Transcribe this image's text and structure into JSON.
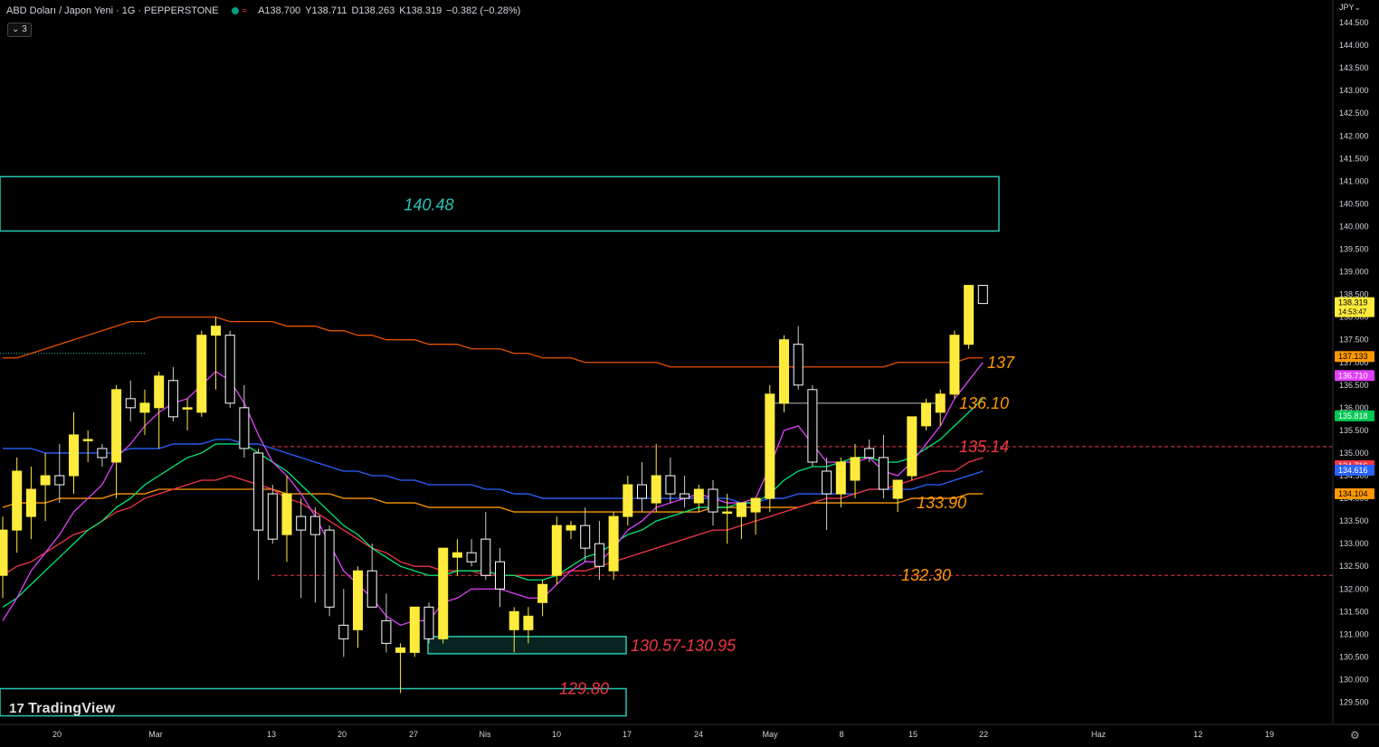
{
  "header": {
    "symbol": "ABD Doları / Japon Yeni · 1G · PEPPERSTONE",
    "wave_glyph": "≈",
    "open": "A138.700",
    "high": "Y138.711",
    "low": "D138.263",
    "close": "K138.319",
    "change": "−0.382 (−0.28%)"
  },
  "indicator_toggle": "⌄ 3",
  "currency_button": "JPY⌄",
  "logo": {
    "mark": "17",
    "text": "TradingView"
  },
  "settings_glyph": "⚙",
  "colors": {
    "bull": "#ffeb3b",
    "bear": "#000000",
    "bear_border": "#ffffff",
    "teal": "#26c6b4",
    "orange": "#ff9800",
    "red": "#f23645",
    "magenta": "#e040fb",
    "green": "#00e676",
    "blue": "#2962ff"
  },
  "chart_data": {
    "type": "candlestick",
    "symbol": "USDJPY",
    "timeframe": "1G",
    "y_axis": {
      "min": 129.3,
      "max": 144.8,
      "ticks": [
        "129.500",
        "130.000",
        "130.500",
        "131.000",
        "131.500",
        "132.000",
        "132.500",
        "133.000",
        "133.500",
        "134.000",
        "134.500",
        "135.000",
        "135.500",
        "136.000",
        "136.500",
        "137.000",
        "137.500",
        "138.000",
        "138.500",
        "139.000",
        "139.500",
        "140.000",
        "140.500",
        "141.000",
        "141.500",
        "142.000",
        "142.500",
        "143.000",
        "143.500",
        "144.000",
        "144.500"
      ]
    },
    "x_axis_labels": [
      "20",
      "Mar",
      "13",
      "20",
      "27",
      "Nis",
      "10",
      "17",
      "24",
      "May",
      "8",
      "15",
      "22",
      "Haz",
      "12",
      "19"
    ],
    "candles": [
      {
        "o": 132.3,
        "h": 133.6,
        "l": 131.8,
        "c": 133.3
      },
      {
        "o": 133.3,
        "h": 134.9,
        "l": 132.8,
        "c": 134.6
      },
      {
        "o": 133.6,
        "h": 134.7,
        "l": 133.1,
        "c": 134.2
      },
      {
        "o": 134.3,
        "h": 135.0,
        "l": 133.5,
        "c": 134.5
      },
      {
        "o": 134.5,
        "h": 135.2,
        "l": 133.9,
        "c": 134.3
      },
      {
        "o": 134.5,
        "h": 135.9,
        "l": 134.1,
        "c": 135.4
      },
      {
        "o": 135.3,
        "h": 135.5,
        "l": 134.8,
        "c": 135.3
      },
      {
        "o": 135.1,
        "h": 135.2,
        "l": 134.7,
        "c": 134.9
      },
      {
        "o": 134.8,
        "h": 136.5,
        "l": 134.0,
        "c": 136.4
      },
      {
        "o": 136.2,
        "h": 136.6,
        "l": 135.7,
        "c": 136.0
      },
      {
        "o": 135.9,
        "h": 136.4,
        "l": 135.4,
        "c": 136.1
      },
      {
        "o": 136.0,
        "h": 136.8,
        "l": 135.1,
        "c": 136.7
      },
      {
        "o": 136.6,
        "h": 136.9,
        "l": 135.7,
        "c": 135.8
      },
      {
        "o": 136.0,
        "h": 136.2,
        "l": 135.5,
        "c": 136.0
      },
      {
        "o": 135.9,
        "h": 137.7,
        "l": 135.8,
        "c": 137.6
      },
      {
        "o": 137.6,
        "h": 138.0,
        "l": 136.4,
        "c": 137.8
      },
      {
        "o": 137.6,
        "h": 137.7,
        "l": 136.0,
        "c": 136.1
      },
      {
        "o": 136.0,
        "h": 136.5,
        "l": 134.9,
        "c": 135.1
      },
      {
        "o": 135.0,
        "h": 135.1,
        "l": 132.2,
        "c": 133.3
      },
      {
        "o": 134.1,
        "h": 134.3,
        "l": 133.0,
        "c": 133.1
      },
      {
        "o": 133.2,
        "h": 134.5,
        "l": 132.6,
        "c": 134.1
      },
      {
        "o": 133.6,
        "h": 134.0,
        "l": 131.8,
        "c": 133.3
      },
      {
        "o": 133.6,
        "h": 133.8,
        "l": 131.7,
        "c": 133.2
      },
      {
        "o": 133.3,
        "h": 133.4,
        "l": 131.4,
        "c": 131.6
      },
      {
        "o": 131.2,
        "h": 132.0,
        "l": 130.5,
        "c": 130.9
      },
      {
        "o": 131.1,
        "h": 132.5,
        "l": 130.7,
        "c": 132.4
      },
      {
        "o": 132.4,
        "h": 133.0,
        "l": 131.6,
        "c": 131.6
      },
      {
        "o": 131.3,
        "h": 131.9,
        "l": 130.6,
        "c": 130.8
      },
      {
        "o": 130.6,
        "h": 130.8,
        "l": 129.7,
        "c": 130.7
      },
      {
        "o": 130.6,
        "h": 131.6,
        "l": 130.5,
        "c": 131.6
      },
      {
        "o": 131.6,
        "h": 131.7,
        "l": 130.8,
        "c": 130.9
      },
      {
        "o": 130.9,
        "h": 132.9,
        "l": 130.8,
        "c": 132.9
      },
      {
        "o": 132.7,
        "h": 133.1,
        "l": 132.3,
        "c": 132.8
      },
      {
        "o": 132.8,
        "h": 133.1,
        "l": 132.5,
        "c": 132.6
      },
      {
        "o": 133.1,
        "h": 133.7,
        "l": 132.2,
        "c": 132.3
      },
      {
        "o": 132.6,
        "h": 132.9,
        "l": 131.6,
        "c": 132.0
      },
      {
        "o": 131.1,
        "h": 131.6,
        "l": 130.6,
        "c": 131.5
      },
      {
        "o": 131.1,
        "h": 131.6,
        "l": 130.8,
        "c": 131.4
      },
      {
        "o": 131.7,
        "h": 132.2,
        "l": 131.4,
        "c": 132.1
      },
      {
        "o": 132.3,
        "h": 133.6,
        "l": 132.1,
        "c": 133.4
      },
      {
        "o": 133.3,
        "h": 133.5,
        "l": 133.1,
        "c": 133.4
      },
      {
        "o": 133.4,
        "h": 133.8,
        "l": 132.6,
        "c": 132.9
      },
      {
        "o": 133.0,
        "h": 133.5,
        "l": 132.2,
        "c": 132.5
      },
      {
        "o": 132.4,
        "h": 133.7,
        "l": 132.2,
        "c": 133.6
      },
      {
        "o": 133.6,
        "h": 134.5,
        "l": 133.4,
        "c": 134.3
      },
      {
        "o": 134.3,
        "h": 134.8,
        "l": 133.7,
        "c": 134.0
      },
      {
        "o": 133.9,
        "h": 135.2,
        "l": 133.7,
        "c": 134.5
      },
      {
        "o": 134.5,
        "h": 134.9,
        "l": 133.9,
        "c": 134.1
      },
      {
        "o": 134.1,
        "h": 134.5,
        "l": 133.8,
        "c": 134.0
      },
      {
        "o": 133.9,
        "h": 134.3,
        "l": 133.7,
        "c": 134.2
      },
      {
        "o": 134.2,
        "h": 134.4,
        "l": 133.4,
        "c": 133.7
      },
      {
        "o": 133.7,
        "h": 134.1,
        "l": 133.0,
        "c": 133.7
      },
      {
        "o": 133.6,
        "h": 133.8,
        "l": 133.1,
        "c": 133.9
      },
      {
        "o": 133.7,
        "h": 134.0,
        "l": 133.2,
        "c": 134.0
      },
      {
        "o": 134.0,
        "h": 136.5,
        "l": 133.7,
        "c": 136.3
      },
      {
        "o": 136.1,
        "h": 137.6,
        "l": 135.9,
        "c": 137.5
      },
      {
        "o": 137.4,
        "h": 137.8,
        "l": 136.4,
        "c": 136.5
      },
      {
        "o": 136.4,
        "h": 136.5,
        "l": 134.7,
        "c": 134.8
      },
      {
        "o": 134.6,
        "h": 134.9,
        "l": 133.3,
        "c": 134.1
      },
      {
        "o": 134.1,
        "h": 134.9,
        "l": 133.8,
        "c": 134.8
      },
      {
        "o": 134.4,
        "h": 135.2,
        "l": 134.0,
        "c": 134.9
      },
      {
        "o": 135.1,
        "h": 135.3,
        "l": 134.8,
        "c": 134.9
      },
      {
        "o": 134.9,
        "h": 135.4,
        "l": 134.0,
        "c": 134.2
      },
      {
        "o": 134.0,
        "h": 134.4,
        "l": 133.7,
        "c": 134.4
      },
      {
        "o": 134.5,
        "h": 135.8,
        "l": 134.4,
        "c": 135.8
      },
      {
        "o": 135.6,
        "h": 136.2,
        "l": 135.5,
        "c": 136.1
      },
      {
        "o": 135.9,
        "h": 136.4,
        "l": 135.6,
        "c": 136.3
      },
      {
        "o": 136.3,
        "h": 137.7,
        "l": 136.2,
        "c": 137.6
      },
      {
        "o": 137.4,
        "h": 138.7,
        "l": 137.3,
        "c": 138.7
      },
      {
        "o": 138.7,
        "h": 138.7,
        "l": 138.3,
        "c": 138.3
      }
    ],
    "moving_averages": [
      {
        "color": "#e65100",
        "values": [
          137.1,
          137.1,
          137.2,
          137.3,
          137.4,
          137.5,
          137.6,
          137.7,
          137.8,
          137.9,
          137.9,
          138.0,
          138.0,
          138.0,
          138.0,
          138.0,
          137.9,
          137.9,
          137.9,
          137.9,
          137.8,
          137.8,
          137.8,
          137.7,
          137.7,
          137.6,
          137.6,
          137.5,
          137.5,
          137.5,
          137.4,
          137.4,
          137.4,
          137.3,
          137.3,
          137.3,
          137.2,
          137.2,
          137.1,
          137.1,
          137.1,
          137.0,
          137.0,
          137.0,
          137.0,
          137.0,
          137.0,
          136.9,
          136.9,
          136.9,
          136.9,
          136.9,
          136.9,
          136.9,
          136.9,
          136.9,
          136.9,
          136.9,
          136.9,
          136.9,
          136.9,
          136.9,
          136.9,
          137.0,
          137.0,
          137.0,
          137.0,
          137.0,
          137.1,
          137.1
        ]
      },
      {
        "color": "#ff9800",
        "values": [
          133.8,
          133.9,
          133.9,
          133.9,
          134.0,
          134.0,
          134.0,
          134.0,
          134.1,
          134.1,
          134.1,
          134.2,
          134.2,
          134.2,
          134.2,
          134.2,
          134.2,
          134.2,
          134.2,
          134.2,
          134.1,
          134.1,
          134.1,
          134.1,
          134.0,
          134.0,
          134.0,
          133.9,
          133.9,
          133.9,
          133.8,
          133.8,
          133.8,
          133.8,
          133.8,
          133.8,
          133.7,
          133.7,
          133.7,
          133.7,
          133.7,
          133.7,
          133.7,
          133.7,
          133.7,
          133.7,
          133.7,
          133.7,
          133.7,
          133.7,
          133.8,
          133.8,
          133.8,
          133.8,
          133.8,
          133.8,
          133.8,
          133.9,
          133.9,
          133.9,
          133.9,
          133.9,
          133.9,
          133.9,
          134.0,
          134.0,
          134.0,
          134.0,
          134.1,
          134.1
        ]
      },
      {
        "color": "#2962ff",
        "values": [
          135.1,
          135.1,
          135.1,
          135.0,
          135.0,
          135.0,
          135.0,
          135.0,
          135.0,
          135.1,
          135.1,
          135.1,
          135.2,
          135.2,
          135.2,
          135.3,
          135.3,
          135.2,
          135.2,
          135.1,
          135.0,
          134.9,
          134.8,
          134.7,
          134.6,
          134.6,
          134.5,
          134.5,
          134.4,
          134.4,
          134.3,
          134.3,
          134.3,
          134.3,
          134.2,
          134.2,
          134.1,
          134.1,
          134.0,
          134.0,
          134.0,
          134.0,
          134.0,
          134.0,
          134.0,
          134.0,
          134.0,
          134.0,
          134.0,
          134.0,
          134.0,
          134.0,
          133.9,
          133.9,
          134.0,
          134.0,
          134.1,
          134.1,
          134.1,
          134.1,
          134.1,
          134.2,
          134.2,
          134.2,
          134.2,
          134.3,
          134.3,
          134.4,
          134.5,
          134.6
        ]
      },
      {
        "color": "#f23645",
        "values": [
          132.3,
          132.5,
          132.6,
          132.8,
          133.0,
          133.2,
          133.3,
          133.5,
          133.7,
          133.8,
          134.0,
          134.1,
          134.2,
          134.3,
          134.4,
          134.4,
          134.5,
          134.4,
          134.3,
          134.2,
          134.0,
          133.9,
          133.7,
          133.5,
          133.3,
          133.1,
          132.9,
          132.8,
          132.6,
          132.5,
          132.5,
          132.4,
          132.4,
          132.4,
          132.3,
          132.3,
          132.3,
          132.3,
          132.3,
          132.3,
          132.4,
          132.4,
          132.5,
          132.6,
          132.7,
          132.8,
          132.9,
          133.0,
          133.1,
          133.2,
          133.3,
          133.3,
          133.4,
          133.5,
          133.6,
          133.7,
          133.8,
          133.9,
          134.0,
          134.0,
          134.1,
          134.2,
          134.2,
          134.3,
          134.4,
          134.5,
          134.6,
          134.6,
          134.8,
          134.9
        ]
      },
      {
        "color": "#00e676",
        "values": [
          131.6,
          131.8,
          132.1,
          132.4,
          132.7,
          133.0,
          133.3,
          133.5,
          133.8,
          134.0,
          134.3,
          134.5,
          134.7,
          134.9,
          135.0,
          135.2,
          135.2,
          135.2,
          135.0,
          134.8,
          134.6,
          134.3,
          134.0,
          133.7,
          133.4,
          133.2,
          132.9,
          132.7,
          132.5,
          132.4,
          132.3,
          132.3,
          132.4,
          132.4,
          132.4,
          132.3,
          132.3,
          132.2,
          132.2,
          132.3,
          132.5,
          132.7,
          132.8,
          133.0,
          133.2,
          133.3,
          133.5,
          133.6,
          133.7,
          133.8,
          133.8,
          133.8,
          133.9,
          133.9,
          134.1,
          134.4,
          134.6,
          134.7,
          134.7,
          134.8,
          134.9,
          134.9,
          134.8,
          134.8,
          134.9,
          135.1,
          135.3,
          135.6,
          135.9,
          136.2
        ]
      },
      {
        "color": "#e040fb",
        "values": [
          131.3,
          131.8,
          132.4,
          132.8,
          133.2,
          133.7,
          134.0,
          134.3,
          134.9,
          135.2,
          135.6,
          135.9,
          136.1,
          136.2,
          136.5,
          136.8,
          136.6,
          136.1,
          135.4,
          134.8,
          134.5,
          134.1,
          133.6,
          133.0,
          132.4,
          132.1,
          131.8,
          131.4,
          131.2,
          131.3,
          131.3,
          131.7,
          131.8,
          132.0,
          132.0,
          132.0,
          131.9,
          131.8,
          131.8,
          132.1,
          132.4,
          132.6,
          132.6,
          132.9,
          133.3,
          133.5,
          133.8,
          133.9,
          134.0,
          134.1,
          134.0,
          133.9,
          133.9,
          134.0,
          134.7,
          135.5,
          135.6,
          135.2,
          134.8,
          134.8,
          134.8,
          134.9,
          134.6,
          134.5,
          134.8,
          135.2,
          135.6,
          136.2,
          136.6,
          137.0
        ]
      }
    ],
    "zones": [
      {
        "label": "140.48",
        "low": 139.9,
        "high": 141.1,
        "color": "#26c6b4"
      },
      {
        "label": "130.57-130.95",
        "low": 130.57,
        "high": 130.95,
        "color": "#26c6b4"
      },
      {
        "label": "129.80",
        "low": 129.2,
        "high": 129.8,
        "color": "#26c6b4"
      }
    ],
    "horizontal_levels": [
      {
        "price": 135.14,
        "label": "135.14",
        "color": "#f23645",
        "style": "dashed"
      },
      {
        "price": 132.3,
        "label": "132.30",
        "color": "#f23645",
        "style": "dashed"
      },
      {
        "price": 136.1,
        "label": "",
        "color": "#bbbbbb",
        "style": "solid"
      },
      {
        "price": 137.2,
        "label": "",
        "color": "#26c6b4",
        "style": "dotted"
      }
    ],
    "annotations": [
      {
        "text": "140.48",
        "color": "#26c6b4"
      },
      {
        "text": "137",
        "color": "#ff9800"
      },
      {
        "text": "136.10",
        "color": "#ff9800"
      },
      {
        "text": "135.14",
        "color": "#f23645"
      },
      {
        "text": "133.90",
        "color": "#ff9800"
      },
      {
        "text": "132.30",
        "color": "#ff9800"
      },
      {
        "text": "130.57-130.95",
        "color": "#f23645"
      },
      {
        "text": "129.80",
        "color": "#f23645"
      }
    ],
    "price_labels": [
      {
        "text": "138.319",
        "sub": "14:53:47",
        "price": 138.32,
        "bg": "#ffeb3b",
        "fg": "#000000"
      },
      {
        "text": "137.133",
        "price": 137.13,
        "bg": "#ff9800",
        "fg": "#000000"
      },
      {
        "text": "136.710",
        "price": 136.71,
        "bg": "#e040fb",
        "fg": "#ffffff"
      },
      {
        "text": "135.818",
        "price": 135.82,
        "bg": "#00c853",
        "fg": "#ffffff"
      },
      {
        "text": "134.716",
        "price": 134.72,
        "bg": "#f23645",
        "fg": "#ffffff"
      },
      {
        "text": "134.616",
        "price": 134.62,
        "bg": "#2962ff",
        "fg": "#ffffff"
      },
      {
        "text": "134.104",
        "price": 134.1,
        "bg": "#ff9800",
        "fg": "#000000"
      }
    ]
  }
}
